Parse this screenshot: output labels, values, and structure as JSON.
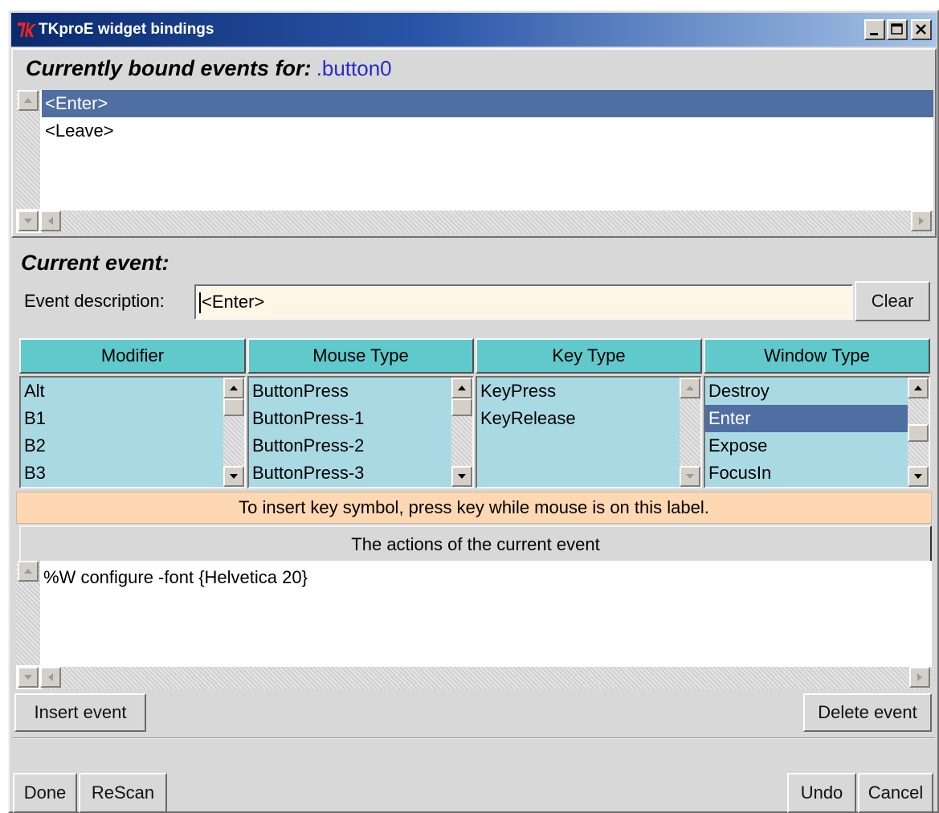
{
  "window": {
    "title": "TKproE widget bindings",
    "logo_text": "7k"
  },
  "bound": {
    "header_label": "Currently bound events for:",
    "widget": ".button0",
    "events": [
      "<Enter>",
      "<Leave>"
    ],
    "selected_index": 0
  },
  "current_event": {
    "header": "Current event:",
    "description_label": "Event description:",
    "description_value": "<Enter>",
    "clear_label": "Clear"
  },
  "types": {
    "columns": [
      {
        "header": "Modifier",
        "items": [
          "Alt",
          "B1",
          "B2",
          "B3"
        ],
        "selected": -1
      },
      {
        "header": "Mouse Type",
        "items": [
          "ButtonPress",
          "ButtonPress-1",
          "ButtonPress-2",
          "ButtonPress-3"
        ],
        "selected": -1
      },
      {
        "header": "Key Type",
        "items": [
          "KeyPress",
          "KeyRelease"
        ],
        "selected": -1
      },
      {
        "header": "Window Type",
        "items": [
          "Destroy",
          "Enter",
          "Expose",
          "FocusIn"
        ],
        "selected": 1
      }
    ]
  },
  "hint": "To insert key symbol, press key while mouse is on this label.",
  "actions": {
    "header": "The actions of the current event",
    "text": "%W configure -font {Helvetica 20}"
  },
  "buttons": {
    "insert_event": "Insert event",
    "delete_event": "Delete event",
    "done": "Done",
    "rescan": "ReScan",
    "undo": "Undo",
    "cancel": "Cancel"
  },
  "colors": {
    "titlebar_start": "#0a2a6e",
    "selection": "#4f6fa3",
    "type_header": "#5fc9cc",
    "type_list": "#a9d9e3",
    "description_bg": "#fdf5e6",
    "hint_bg": "#fdd8b2",
    "widget_name": "#2a2ac8"
  }
}
